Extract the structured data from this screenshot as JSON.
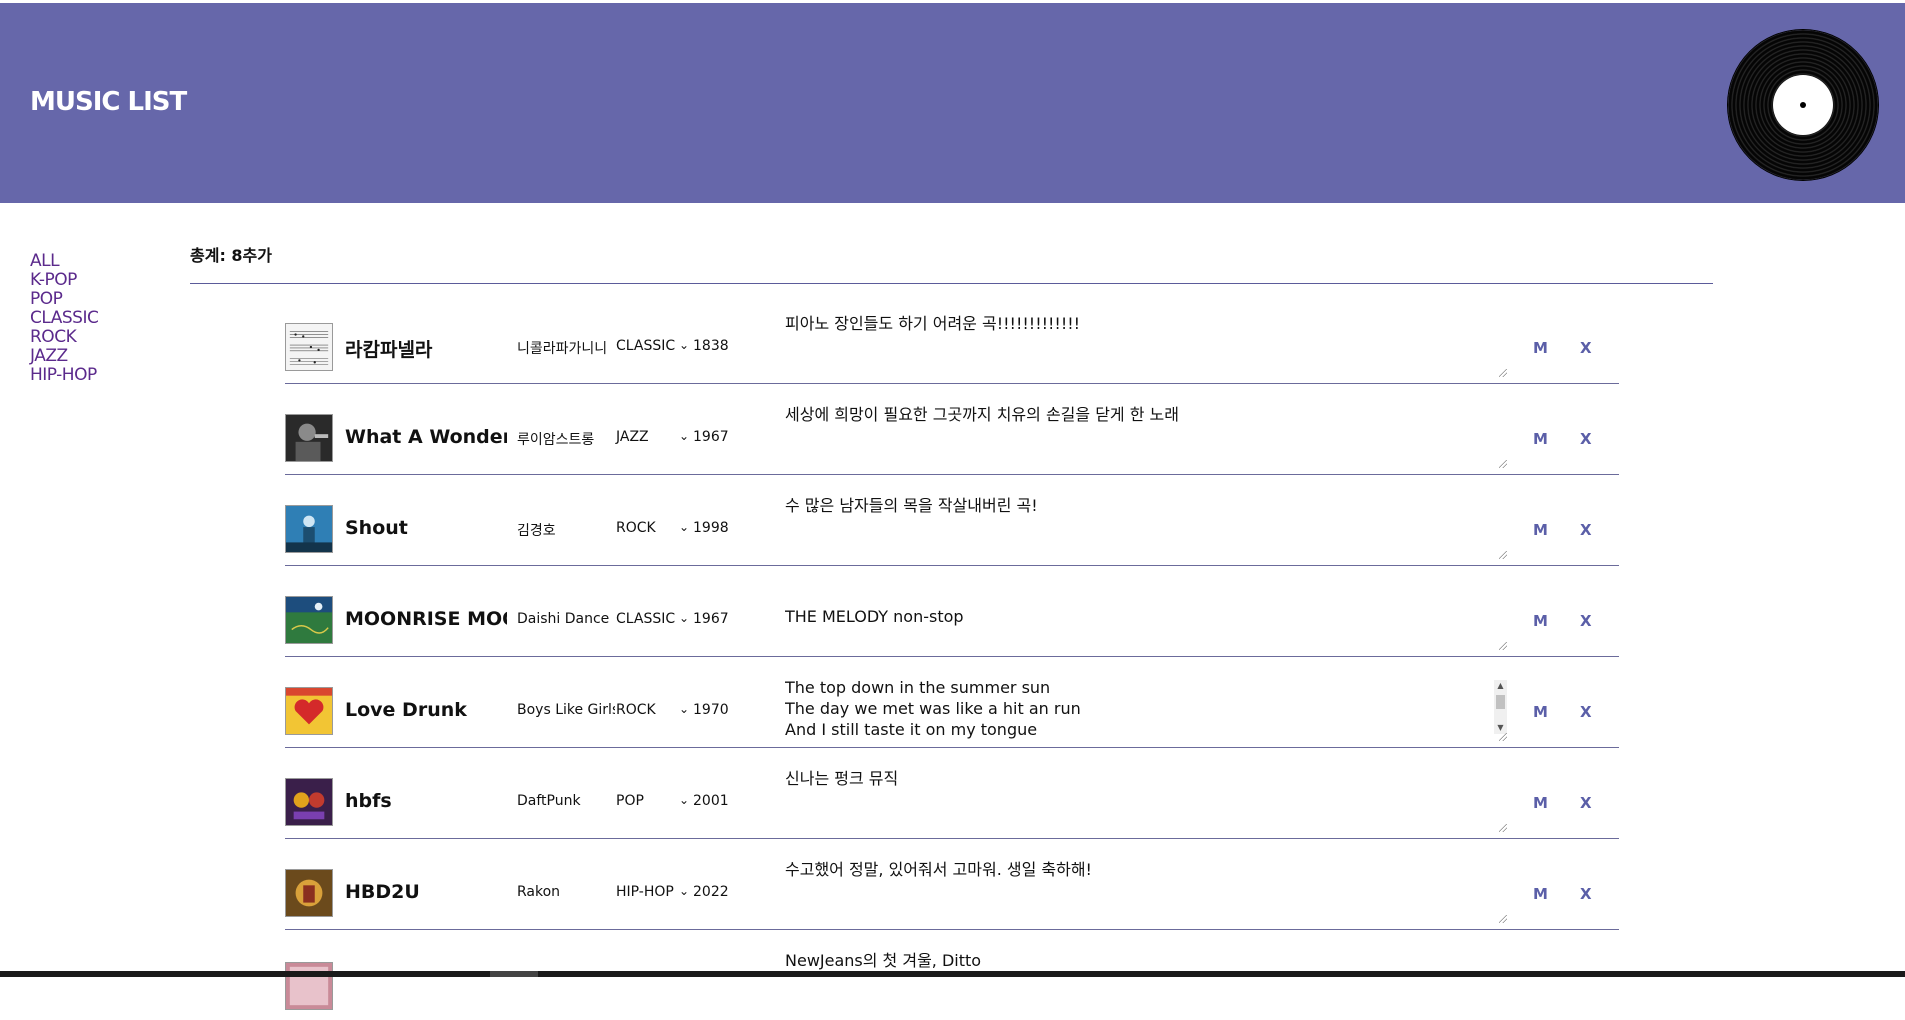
{
  "header": {
    "title": "MUSIC LIST"
  },
  "nav": {
    "items": [
      {
        "label": "ALL"
      },
      {
        "label": "K-POP"
      },
      {
        "label": "POP"
      },
      {
        "label": "CLASSIC"
      },
      {
        "label": "ROCK"
      },
      {
        "label": "JAZZ"
      },
      {
        "label": "HIP-HOP"
      }
    ]
  },
  "summary": {
    "text": "총계: 8추가"
  },
  "colors": {
    "header_bg": "#6667aa",
    "nav_text": "#5b2a8c",
    "action_text": "#5b5fa8",
    "divider": "#6b6b9b"
  },
  "songs": [
    {
      "title": "라캄파넬라",
      "artist": "니콜라파가니니",
      "genre": "CLASSIC",
      "year": "1838",
      "memo": "피아노 장인들도 하기 어려운 곡!!!!!!!!!!!!!",
      "thumb": "sheet-music-icon",
      "m_label": "M",
      "x_label": "X"
    },
    {
      "title": "What A Wonderful",
      "artist": "루이암스트롱",
      "genre": "JAZZ",
      "year": "1967",
      "memo": "세상에 희망이 필요한 그곳까지 치유의 손길을 닫게 한 노래",
      "thumb": "portrait-icon",
      "m_label": "M",
      "x_label": "X"
    },
    {
      "title": "Shout",
      "artist": "김경호",
      "genre": "ROCK",
      "year": "1998",
      "memo": "수 많은 남자들의 목을 작살내버린 곡!",
      "thumb": "concert-icon",
      "m_label": "M",
      "x_label": "X"
    },
    {
      "title": "MOONRISE MOONS",
      "artist": "Daishi Dance",
      "genre": "CLASSIC",
      "year": "1967",
      "memo": "THE MELODY non-stop",
      "thumb": "landscape-icon",
      "m_label": "M",
      "x_label": "X"
    },
    {
      "title": "Love Drunk",
      "artist": "Boys Like Girls",
      "genre": "ROCK",
      "year": "1970",
      "memo": "The top down in the summer sun\nThe day we met was like a hit an run\nAnd I still taste it on my tongue",
      "thumb": "heart-cover-icon",
      "m_label": "M",
      "x_label": "X",
      "scroll": true
    },
    {
      "title": "hbfs",
      "artist": "DaftPunk",
      "genre": "POP",
      "year": "2001",
      "memo": "신나는 펑크 뮤직",
      "thumb": "robot-cover-icon",
      "m_label": "M",
      "x_label": "X"
    },
    {
      "title": "HBD2U",
      "artist": "Rakon",
      "genre": "HIP-HOP",
      "year": "2022",
      "memo": "수고했어 정말, 있어줘서 고마워. 생일 축하해!",
      "thumb": "album-cover-icon",
      "m_label": "M",
      "x_label": "X"
    },
    {
      "title": "",
      "artist": "",
      "genre": "",
      "year": "",
      "memo": "NewJeans의 첫 겨울, Ditto",
      "thumb": "pink-cover-icon",
      "m_label": "",
      "x_label": ""
    }
  ]
}
